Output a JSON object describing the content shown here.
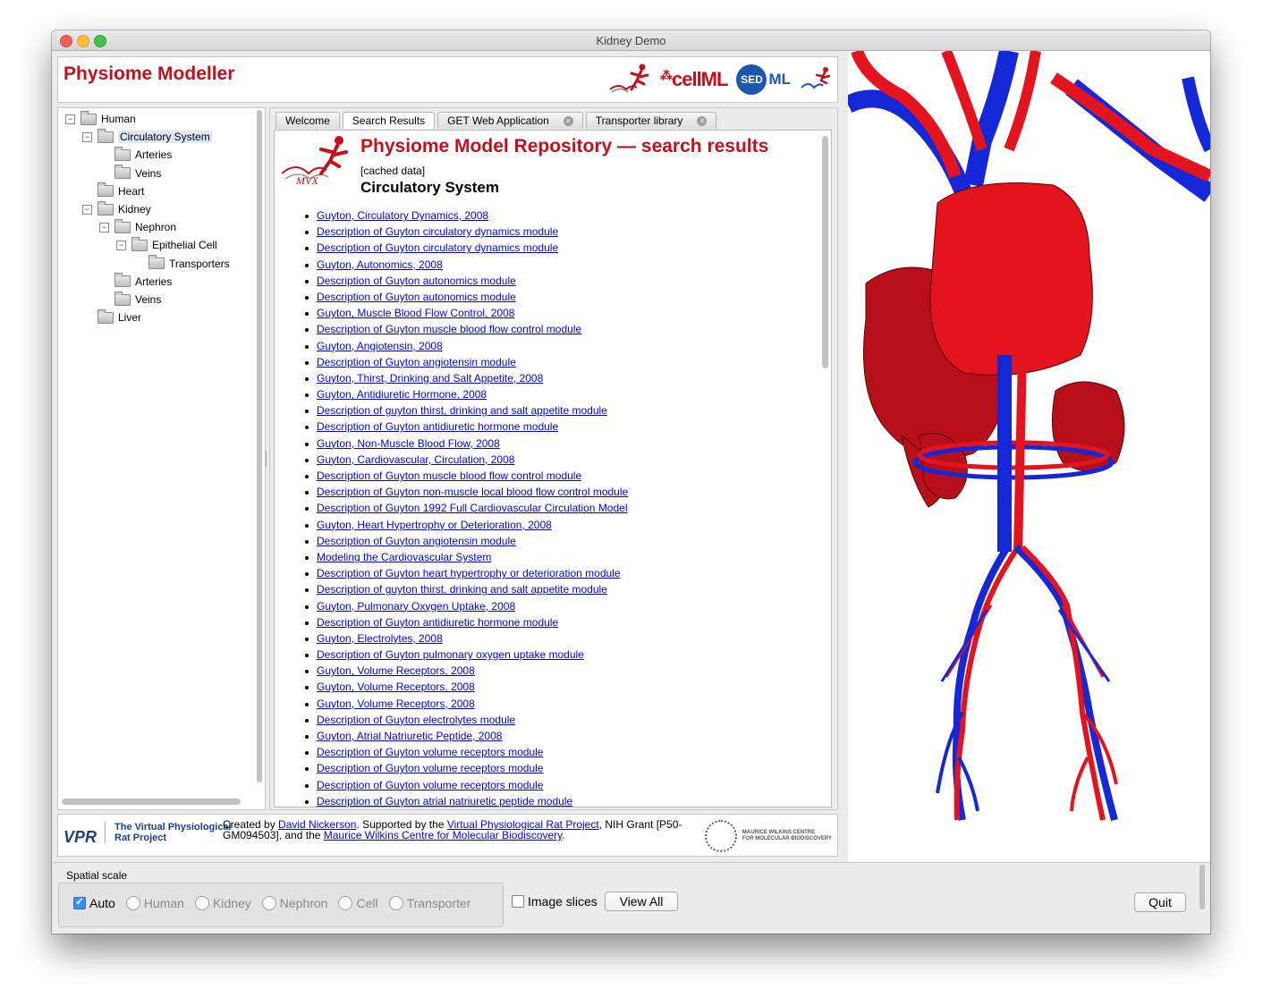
{
  "window": {
    "title": "Kidney Demo"
  },
  "header": {
    "title": "Physiome Modeller",
    "logos": [
      "pmr-runner-icon",
      "cellml-logo",
      "sedml-logo",
      "pmr-runner-icon"
    ],
    "cellml_text": "cellML",
    "sed_text": "SED",
    "sed_ml_text": "ML"
  },
  "tree": {
    "items": [
      {
        "label": "Human",
        "level": 0,
        "expander": "−",
        "selected": false
      },
      {
        "label": "Circulatory System",
        "level": 1,
        "expander": "−",
        "selected": true
      },
      {
        "label": "Arteries",
        "level": 2,
        "expander": "",
        "selected": false
      },
      {
        "label": "Veins",
        "level": 2,
        "expander": "",
        "selected": false
      },
      {
        "label": "Heart",
        "level": 1,
        "expander": "",
        "selected": false
      },
      {
        "label": "Kidney",
        "level": 1,
        "expander": "−",
        "selected": false
      },
      {
        "label": "Nephron",
        "level": 2,
        "expander": "−",
        "selected": false
      },
      {
        "label": "Epithelial Cell",
        "level": 3,
        "expander": "−",
        "selected": false
      },
      {
        "label": "Transporters",
        "level": 4,
        "expander": "",
        "selected": false
      },
      {
        "label": "Arteries",
        "level": 2,
        "expander": "",
        "selected": false
      },
      {
        "label": "Veins",
        "level": 2,
        "expander": "",
        "selected": false
      },
      {
        "label": "Liver",
        "level": 1,
        "expander": "",
        "selected": false
      }
    ]
  },
  "tabs": [
    {
      "label": "Welcome",
      "active": false,
      "closable": false
    },
    {
      "label": "Search Results",
      "active": true,
      "closable": false
    },
    {
      "label": "GET Web Application",
      "active": false,
      "closable": true
    },
    {
      "label": "Transporter library",
      "active": false,
      "closable": true
    }
  ],
  "results_page": {
    "title": "Physiome Model Repository — search results",
    "cached": "[cached data]",
    "subtitle": "Circulatory System",
    "links": [
      "Guyton, Circulatory Dynamics, 2008",
      "Description of Guyton circulatory dynamics module",
      "Description of Guyton circulatory dynamics module",
      "Guyton, Autonomics, 2008",
      "Description of Guyton autonomics module",
      "Description of Guyton autonomics module",
      "Guyton, Muscle Blood Flow Control, 2008",
      "Description of Guyton muscle blood flow control module",
      "Guyton, Angiotensin, 2008",
      "Description of Guyton angiotensin module",
      "Guyton, Thirst, Drinking and Salt Appetite, 2008",
      "Guyton, Antidiuretic Hormone, 2008",
      "Description of guyton thirst, drinking and salt appetite module",
      "Description of Guyton antidiuretic hormone module",
      "Guyton, Non-Muscle Blood Flow, 2008",
      "Guyton, Cardiovascular, Circulation, 2008",
      "Description of Guyton muscle blood flow control module",
      "Description of Guyton non-muscle local blood flow control module",
      "Description of Guyton 1992 Full Cardiovascular Circulation Model",
      "Guyton, Heart Hypertrophy or Deterioration, 2008",
      "Description of Guyton angiotensin module",
      "Modeling the Cardiovascular System",
      "Description of Guyton heart hypertrophy or deterioration module",
      "Description of guyton thirst, drinking and salt appetite module",
      "Guyton, Pulmonary Oxygen Uptake, 2008",
      "Description of Guyton antidiuretic hormone module",
      "Guyton, Electrolytes, 2008",
      "Description of Guyton pulmonary oxygen uptake module",
      "Guyton, Volume Receptors, 2008",
      "Guyton, Volume Receptors, 2008",
      "Guyton, Volume Receptors, 2008",
      "Description of Guyton electrolytes module",
      "Guyton, Atrial Natriuretic Peptide, 2008",
      "Description of Guyton volume receptors module",
      "Description of Guyton volume receptors module",
      "Description of Guyton volume receptors module",
      "Description of Guyton atrial natriuretic peptide module"
    ]
  },
  "footer": {
    "vpr": "VPR",
    "vpr_name_1": "The Virtual Physiological",
    "vpr_name_2": "Rat Project",
    "created_by": "Created by ",
    "author": "David Nickerson",
    "supported": ". Supported by the ",
    "vpr_link": "Virtual Physiological Rat Project",
    "grant": ", NIH Grant [P50-GM094503], and the ",
    "mwc_link": "Maurice Wilkins Centre for Molecular Biodiscovery",
    "end": ".",
    "mwc_text_1": "MAURICE WILKINS CENTRE",
    "mwc_text_2": "FOR MOLECULAR BIODISCOVERY"
  },
  "controls": {
    "group_title": "Spatial scale",
    "auto_label": "Auto",
    "auto_checked": true,
    "scales": [
      "Human",
      "Kidney",
      "Nephron",
      "Cell",
      "Transporter"
    ],
    "image_slices_label": "Image slices",
    "image_slices_checked": false,
    "view_all": "View All",
    "quit": "Quit"
  },
  "colors": {
    "brand_red": "#c50f1b",
    "link_blue": "#0000ee",
    "artery_red": "#e3141e",
    "vein_blue": "#1428d8"
  }
}
